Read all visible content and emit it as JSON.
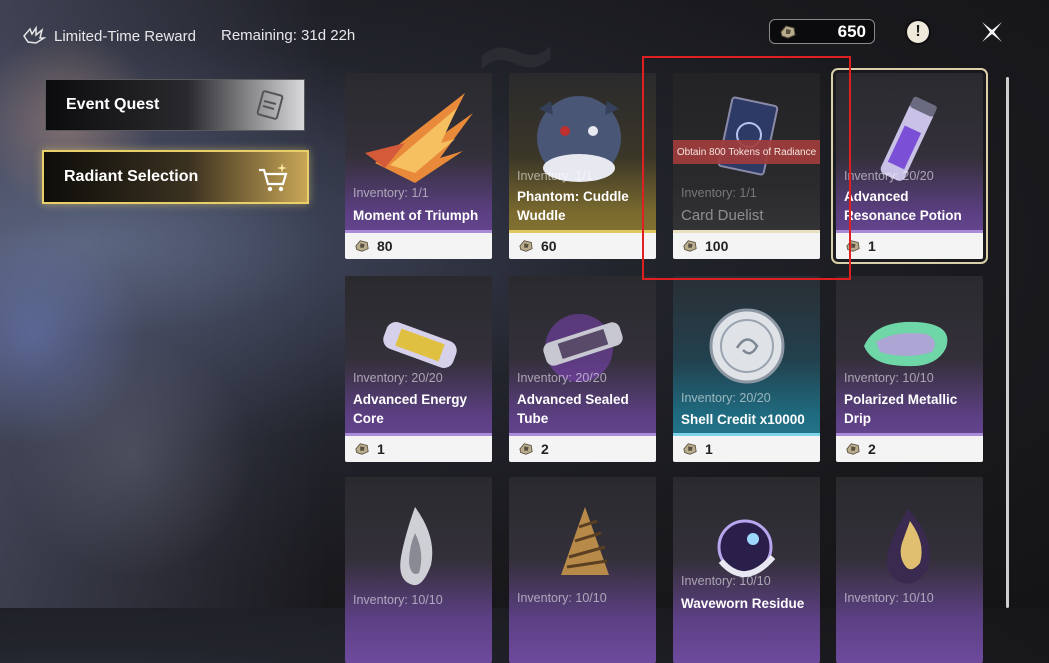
{
  "header": {
    "title": "Limited-Time Reward",
    "remaining": "Remaining: 31d 22h",
    "currency_amount": "650",
    "alert_symbol": "!",
    "colors": {
      "currency_border": "#8a8a8e",
      "alert_bg": "#efe9dc"
    }
  },
  "sidebar": {
    "items": [
      {
        "label": "Event Quest",
        "icon": "quest-document-icon"
      },
      {
        "label": "Radiant Selection",
        "icon": "shopping-cart-icon",
        "active": true
      }
    ],
    "colors": {
      "active_border": "#e8cf6a"
    }
  },
  "items": [
    {
      "inventory": "Inventory: 1/1",
      "name": "Moment of Triumph",
      "price": "80",
      "rarity": "purple",
      "icon": "flaming-wing-icon"
    },
    {
      "inventory": "Inventory: 1/1",
      "name": "Phantom: Cuddle Wuddle",
      "price": "60",
      "rarity": "gold",
      "icon": "plush-bear-icon"
    },
    {
      "inventory": "Inventory: 1/1",
      "name": "Card Duelist",
      "price": "100",
      "rarity": "dim",
      "icon": "card-icon",
      "locked_note": "Obtain 800 Tokens of Radiance",
      "highlighted": true
    },
    {
      "inventory": "Inventory: 20/20",
      "name": "Advanced Resonance Potion",
      "price": "1",
      "rarity": "purple",
      "icon": "potion-vial-icon",
      "selected": true
    },
    {
      "inventory": "Inventory: 20/20",
      "name": "Advanced Energy Core",
      "price": "1",
      "rarity": "purple",
      "icon": "energy-core-icon"
    },
    {
      "inventory": "Inventory: 20/20",
      "name": "Advanced Sealed Tube",
      "price": "2",
      "rarity": "purple",
      "icon": "sealed-tube-icon"
    },
    {
      "inventory": "Inventory: 20/20",
      "name": "Shell Credit x10000",
      "price": "1",
      "rarity": "blue",
      "icon": "shell-credit-coin-icon"
    },
    {
      "inventory": "Inventory: 10/10",
      "name": "Polarized Metallic Drip",
      "price": "2",
      "rarity": "purple",
      "icon": "metallic-drip-icon"
    },
    {
      "inventory": "Inventory: 10/10",
      "name": "",
      "price": "",
      "rarity": "purple",
      "icon": "silver-flame-icon"
    },
    {
      "inventory": "Inventory: 10/10",
      "name": "",
      "price": "",
      "rarity": "purple",
      "icon": "spiral-drill-icon"
    },
    {
      "inventory": "Inventory: 10/10",
      "name": "Waveworn Residue",
      "price": "",
      "rarity": "purple",
      "icon": "waveworn-orb-icon"
    },
    {
      "inventory": "Inventory: 10/10",
      "name": "",
      "price": "",
      "rarity": "purple",
      "icon": "dark-flame-icon"
    }
  ]
}
